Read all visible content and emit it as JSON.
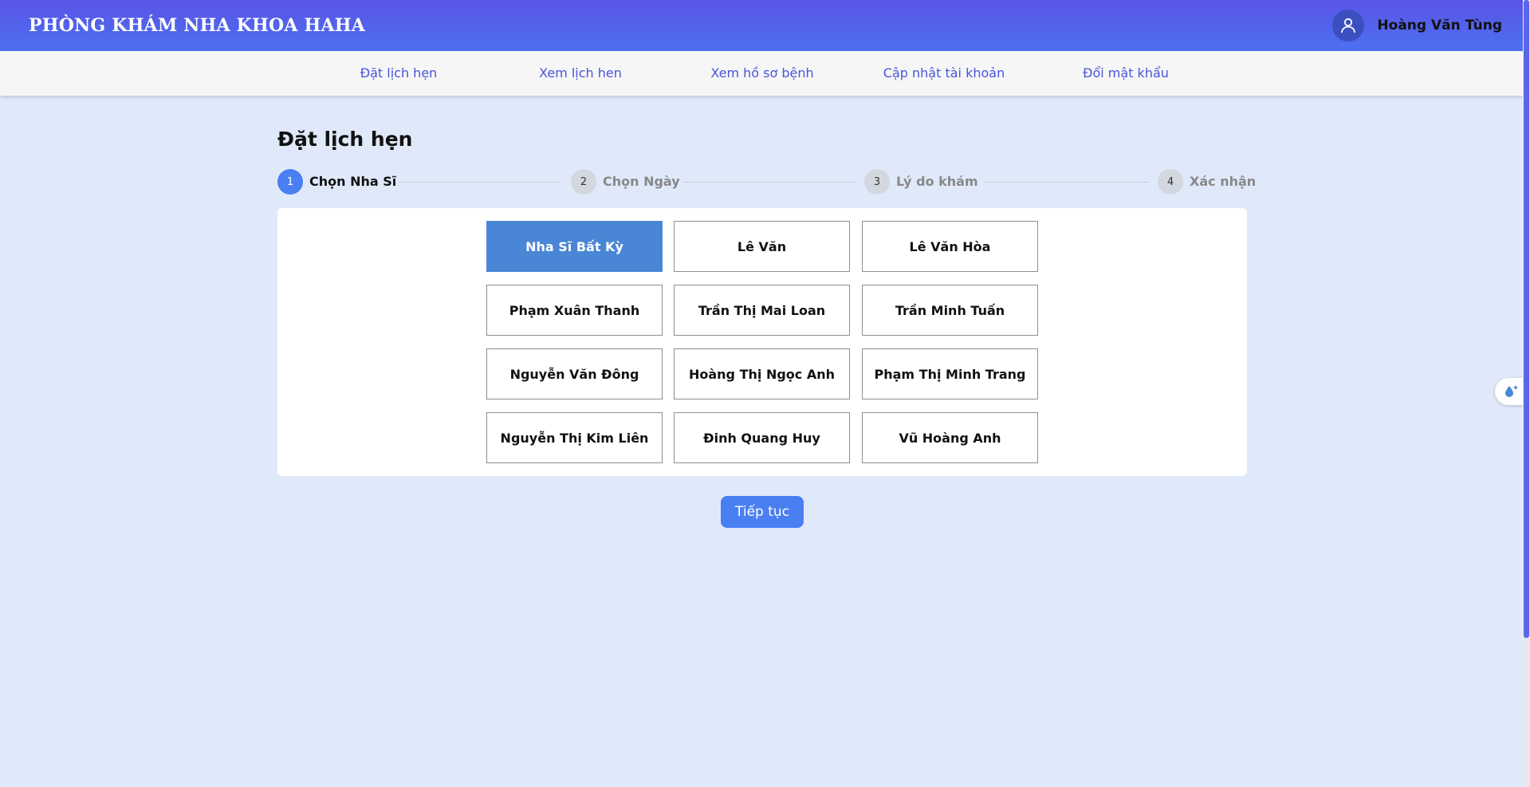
{
  "header": {
    "brand": "PHÒNG KHÁM NHA KHOA HAHA",
    "user_name": "Hoàng Văn Tùng"
  },
  "nav": {
    "items": [
      {
        "label": "Đặt lịch hẹn"
      },
      {
        "label": "Xem lịch hen"
      },
      {
        "label": "Xem hồ sơ bệnh"
      },
      {
        "label": "Cập nhật tài khoản"
      },
      {
        "label": "Đổi mật khẩu"
      }
    ]
  },
  "page": {
    "title": "Đặt lịch hẹn"
  },
  "steps": [
    {
      "number": "1",
      "label": "Chọn Nha Sĩ",
      "active": true
    },
    {
      "number": "2",
      "label": "Chọn Ngày",
      "active": false
    },
    {
      "number": "3",
      "label": "Lý do khám",
      "active": false
    },
    {
      "number": "4",
      "label": "Xác nhận",
      "active": false
    }
  ],
  "dentists": [
    {
      "name": "Nha Sĩ Bất Kỳ",
      "selected": true
    },
    {
      "name": "Lê Văn",
      "selected": false
    },
    {
      "name": "Lê Văn Hòa",
      "selected": false
    },
    {
      "name": "Phạm Xuân Thanh",
      "selected": false
    },
    {
      "name": "Trần Thị Mai Loan",
      "selected": false
    },
    {
      "name": "Trần Minh Tuấn",
      "selected": false
    },
    {
      "name": "Nguyễn Văn Đông",
      "selected": false
    },
    {
      "name": "Hoàng Thị Ngọc Anh",
      "selected": false
    },
    {
      "name": "Phạm Thị Minh Trang",
      "selected": false
    },
    {
      "name": "Nguyễn Thị Kim Liên",
      "selected": false
    },
    {
      "name": "Đinh Quang Huy",
      "selected": false
    },
    {
      "name": "Vũ Hoàng Anh",
      "selected": false
    }
  ],
  "actions": {
    "continue_label": "Tiếp tục"
  },
  "icons": {
    "avatar": "user-icon",
    "side_widget": "water-drop-sparkle-icon"
  },
  "colors": {
    "header_start": "#5a54e6",
    "header_end": "#4b70ef",
    "accent": "#4a7ff2",
    "selected": "#4a86d6",
    "nav_text": "#4a55d8",
    "background": "#e0e9fa"
  }
}
